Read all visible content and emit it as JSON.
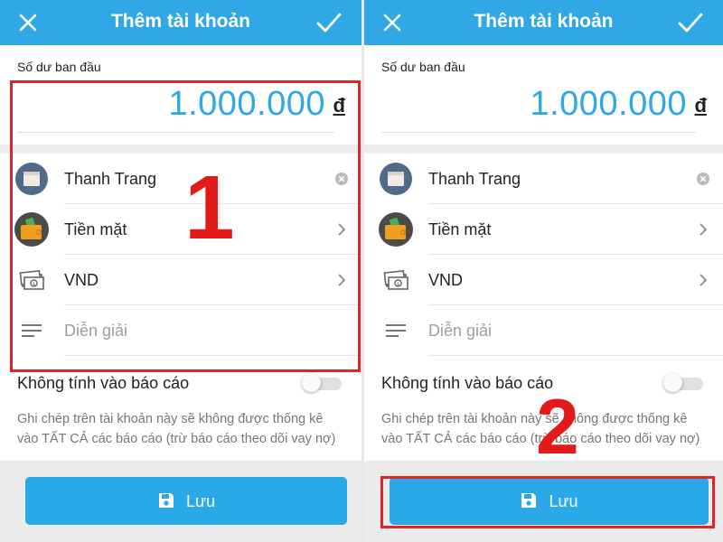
{
  "screens": [
    {
      "header": {
        "title": "Thêm tài khoản"
      },
      "balance": {
        "label": "Số dư ban đầu",
        "amount": "1.000.000",
        "currency": "đ"
      },
      "list": [
        {
          "label": "Thanh Trang",
          "icon": "account-icon",
          "action": "clear"
        },
        {
          "label": "Tiền mặt",
          "icon": "wallet-icon",
          "action": "chevron"
        },
        {
          "label": "VND",
          "icon": "currency-icon",
          "action": "chevron"
        },
        {
          "placeholder": "Diễn giải",
          "icon": "notes-icon"
        }
      ],
      "exclude": {
        "label": "Không tính vào báo cáo",
        "enabled": false,
        "note": "Ghi chép trên tài khoản này sẽ không được thống kê vào TẤT CẢ các báo cáo (trừ báo cáo theo dõi vay nợ)"
      },
      "save_label": "Lưu"
    },
    {
      "header": {
        "title": "Thêm tài khoản"
      },
      "balance": {
        "label": "Số dư ban đầu",
        "amount": "1.000.000",
        "currency": "đ"
      },
      "list": [
        {
          "label": "Thanh Trang",
          "icon": "account-icon",
          "action": "clear"
        },
        {
          "label": "Tiền mặt",
          "icon": "wallet-icon",
          "action": "chevron"
        },
        {
          "label": "VND",
          "icon": "currency-icon",
          "action": "chevron"
        },
        {
          "placeholder": "Diễn giải",
          "icon": "notes-icon"
        }
      ],
      "exclude": {
        "label": "Không tính vào báo cáo",
        "enabled": false,
        "note": "Ghi chép trên tài khoản này sẽ không được thống kê vào TẤT CẢ các báo cáo (trừ báo cáo theo dõi vay nợ)"
      },
      "save_label": "Lưu"
    }
  ],
  "annotations": {
    "step1": "1",
    "step2": "2"
  },
  "colors": {
    "primary": "#2fa8e5",
    "highlight": "#e32424",
    "button": "#2aa9e9"
  }
}
